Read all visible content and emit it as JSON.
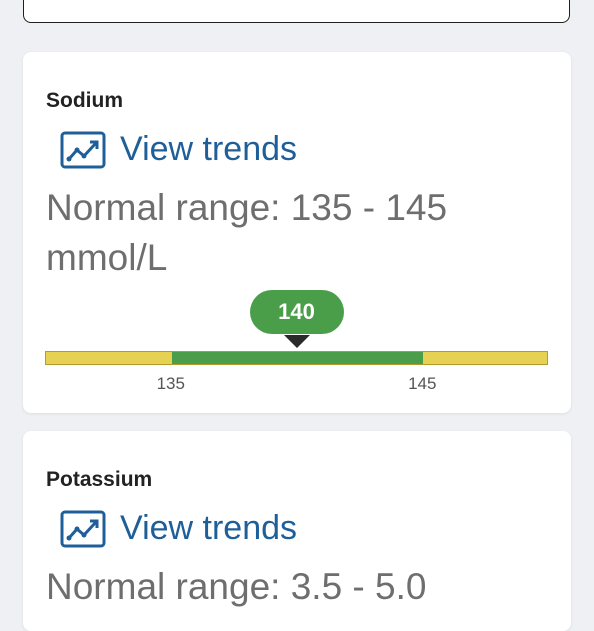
{
  "cards": [
    {
      "title": "Sodium",
      "trend_label": "View trends",
      "range_text": "Normal range: 135 - 145 mmol/L",
      "value": "140",
      "range_min": "135",
      "range_max": "145",
      "scale_min": 130,
      "scale_max": 150,
      "colors": {
        "normal": "#4b9e49",
        "abnormal": "#e6d152",
        "marker": "#4b9e49"
      }
    },
    {
      "title": "Potassium",
      "trend_label": "View trends",
      "range_text": "Normal range: 3.5 - 5.0"
    }
  ],
  "icons": {
    "trend": "trend-chart-icon"
  }
}
